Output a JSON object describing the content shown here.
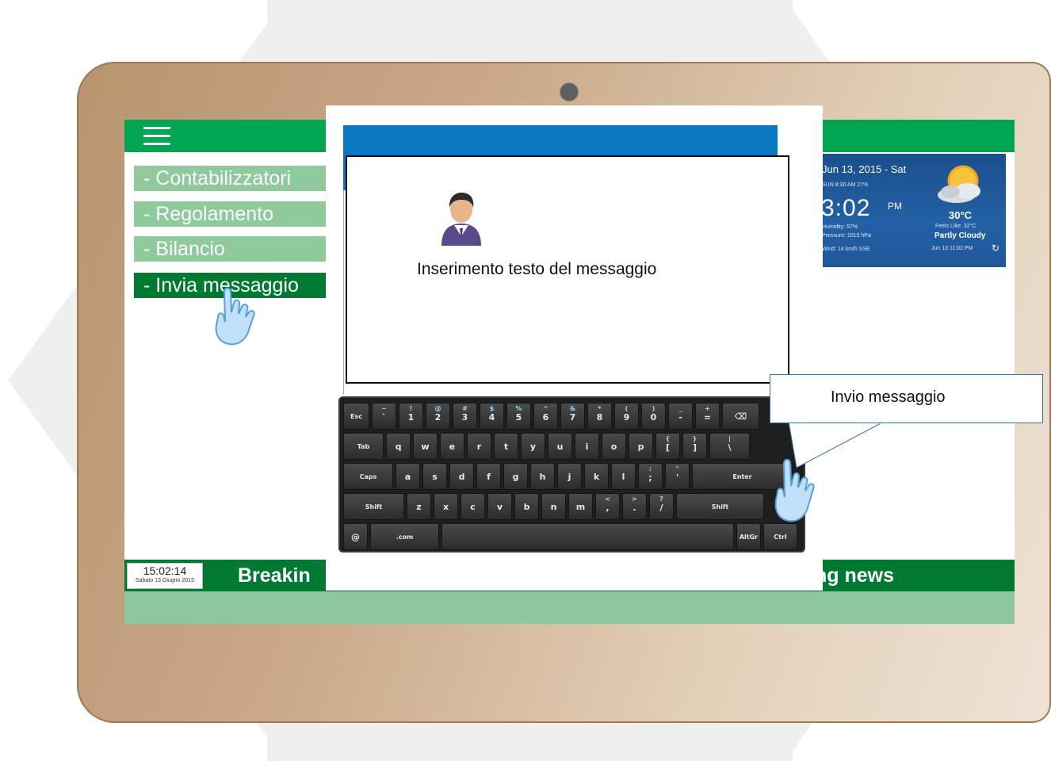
{
  "menu": {
    "items": [
      {
        "label": "- Contabilizzatori"
      },
      {
        "label": "- Regolamento"
      },
      {
        "label": "- Bilancio"
      },
      {
        "label": "- Invia messaggio"
      }
    ],
    "hamburger_icon": "hamburger-menu-icon"
  },
  "weather": {
    "date": "Jun 13, 2015 - Sat",
    "sun_moon": "SUN 8:30 AM  27%",
    "time": "3:02",
    "ampm": "PM",
    "humidity": "Humidity: 57%",
    "pressure": "Pressure: 1015 hPa",
    "wind": "Wind: 14 km/h SSE",
    "temperature": "30°C",
    "feels_like": "Feels Like: 32°C",
    "condition": "Partly Cloudy",
    "updated": "Jun 13  11:02 PM",
    "refresh_icon": "refresh-icon"
  },
  "clock": {
    "time": "15:02:14",
    "date": "Sabato 13 Giugno 2015"
  },
  "ticker": {
    "left_text": "Breakin",
    "right_text": "ng news"
  },
  "dialog": {
    "message_label": "Inserimento testo del messaggio"
  },
  "callout": {
    "text": "Invio messaggio"
  },
  "keyboard": {
    "rows": [
      [
        {
          "main": "Esc"
        },
        {
          "top": "~",
          "main": "`"
        },
        {
          "top": "!",
          "main": "1"
        },
        {
          "top": "@",
          "main": "2"
        },
        {
          "top": "#",
          "main": "3"
        },
        {
          "top": "$",
          "main": "4"
        },
        {
          "top": "%",
          "main": "5"
        },
        {
          "top": "^",
          "main": "6"
        },
        {
          "top": "&",
          "main": "7"
        },
        {
          "top": "*",
          "main": "8"
        },
        {
          "top": "(",
          "main": "9"
        },
        {
          "top": ")",
          "main": "0"
        },
        {
          "top": "_",
          "main": "-"
        },
        {
          "top": "+",
          "main": "="
        },
        {
          "main": "⌫"
        }
      ],
      [
        {
          "main": "Tab"
        },
        {
          "main": "q"
        },
        {
          "main": "w"
        },
        {
          "main": "e"
        },
        {
          "main": "r"
        },
        {
          "main": "t"
        },
        {
          "main": "y"
        },
        {
          "main": "u"
        },
        {
          "main": "i"
        },
        {
          "main": "o"
        },
        {
          "main": "p"
        },
        {
          "top": "{",
          "main": "["
        },
        {
          "top": "}",
          "main": "]"
        },
        {
          "top": "|",
          "main": "\\"
        }
      ],
      [
        {
          "main": "Caps"
        },
        {
          "main": "a"
        },
        {
          "main": "s"
        },
        {
          "main": "d"
        },
        {
          "main": "f"
        },
        {
          "main": "g"
        },
        {
          "main": "h"
        },
        {
          "main": "j"
        },
        {
          "main": "k"
        },
        {
          "main": "l"
        },
        {
          "top": ":",
          "main": ";"
        },
        {
          "top": "\"",
          "main": "'"
        },
        {
          "main": "Enter"
        }
      ],
      [
        {
          "main": "Shift"
        },
        {
          "main": "z"
        },
        {
          "main": "x"
        },
        {
          "main": "c"
        },
        {
          "main": "v"
        },
        {
          "main": "b"
        },
        {
          "main": "n"
        },
        {
          "main": "m"
        },
        {
          "top": "<",
          "main": ","
        },
        {
          "top": ">",
          "main": "."
        },
        {
          "top": "?",
          "main": "/"
        },
        {
          "main": "Shift"
        }
      ],
      [
        {
          "main": "@"
        },
        {
          "main": ".com"
        },
        {
          "main": ""
        },
        {
          "main": "AltGr"
        },
        {
          "main": "Ctrl"
        }
      ]
    ]
  },
  "colors": {
    "topbar_green": "#00a651",
    "menu_green": "#8fca9c",
    "menu_active": "#007a33",
    "ticker_green": "#007a33",
    "bottom_green": "#8dc69f",
    "dialog_blue": "#0a78c3"
  },
  "icons": {
    "user_avatar": "user-avatar-icon",
    "tap_hand": "tap-hand-icon",
    "weather_sun_cloud": "partly-cloudy-icon",
    "camera": "camera-icon"
  }
}
